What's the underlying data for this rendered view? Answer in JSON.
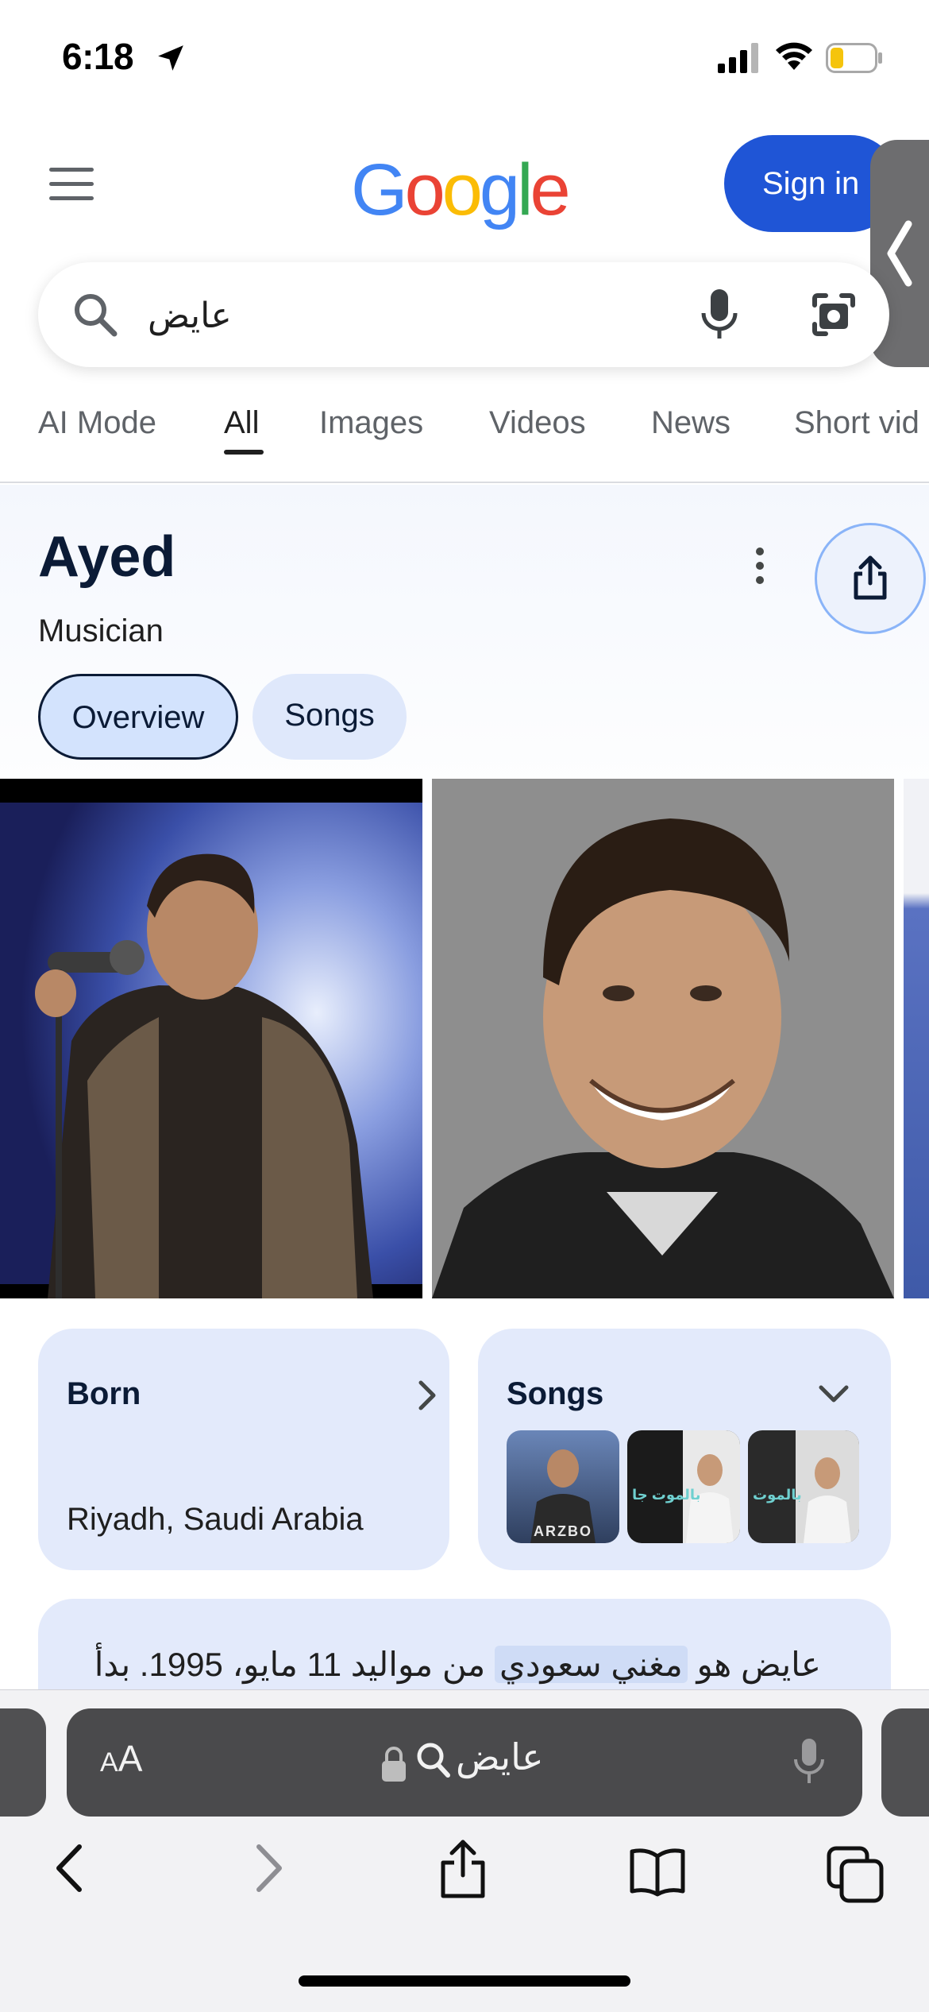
{
  "status_bar": {
    "time": "6:18"
  },
  "header": {
    "logo": "Google",
    "sign_in_label": "Sign in"
  },
  "search": {
    "query": "عايض"
  },
  "tabs": [
    {
      "label": "AI Mode",
      "active": false
    },
    {
      "label": "All",
      "active": true
    },
    {
      "label": "Images",
      "active": false
    },
    {
      "label": "Videos",
      "active": false
    },
    {
      "label": "News",
      "active": false
    },
    {
      "label": "Short vid",
      "active": false
    }
  ],
  "entity": {
    "title": "Ayed",
    "subtitle": "Musician",
    "chips": [
      {
        "label": "Overview",
        "selected": true
      },
      {
        "label": "Songs",
        "selected": false
      }
    ]
  },
  "cards": {
    "born": {
      "title": "Born",
      "value": "Riyadh, Saudi Arabia"
    },
    "songs": {
      "title": "Songs",
      "thumbnails": [
        {
          "icon": "album-cover-icon",
          "label": "ARZBO"
        },
        {
          "icon": "album-cover-icon",
          "label": "بالموت جا"
        },
        {
          "icon": "album-cover-icon",
          "label": "بالموت"
        }
      ]
    }
  },
  "description": {
    "before": "عايض هو ",
    "highlight": "مغني سعودي",
    "after": " من مواليد 11 مايو، 1995. بدأ"
  },
  "browser": {
    "aa_label_small": "A",
    "aa_label_large": "A",
    "address": "عايض"
  },
  "colors": {
    "brand_blue": "#1f55d6",
    "chip_bg": "#d3e3fd",
    "card_bg": "#e3eafb",
    "google_blue": "#4285f4",
    "google_red": "#ea4335",
    "google_yellow": "#fbbc05",
    "google_green": "#34a853"
  }
}
